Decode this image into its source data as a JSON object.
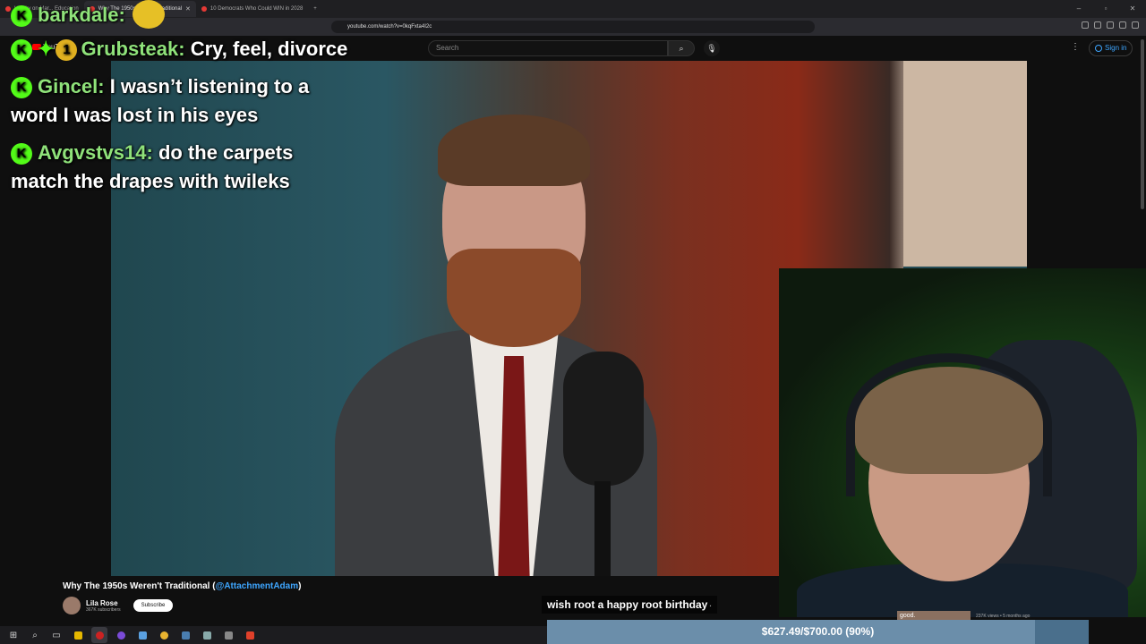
{
  "browser": {
    "tabs": [
      {
        "label": "Livinky on Mar... Education",
        "active": false
      },
      {
        "label": "Why The 1950s Weren't Traditional",
        "active": true
      },
      {
        "label": "10 Democrats Who Could WIN in 2028",
        "active": false
      }
    ],
    "url": "youtube.com/watch?v=0kqFxta4I2c"
  },
  "youtube": {
    "logo_text": "YouTube",
    "search_placeholder": "Search",
    "sign_in": "Sign in"
  },
  "chat": [
    {
      "user": "barkdale:",
      "message": ""
    },
    {
      "user": "Grubsteak:",
      "message": "Cry, feel, divorce"
    },
    {
      "user": "Gincel:",
      "message": "I wasn’t listening to a word I was lost in his eyes"
    },
    {
      "user": "Avgvstvs14:",
      "message": "do the carpets match the drapes with twileks"
    }
  ],
  "badge_one": "1",
  "video": {
    "title": "Why The 1950s Weren't Traditional (",
    "handle": "@AttachmentAdam",
    "title_end": ")",
    "channel": "Lila Rose",
    "subscribers": "367K subscribers",
    "subscribe_label": "Subscribe"
  },
  "caption": "wish root a happy root birthday",
  "mini": {
    "thumb_text": "good.",
    "views": "237K views • 5 months ago"
  },
  "goal": {
    "text": "$627.49/$700.00 (90%)",
    "current": 627.49,
    "target": 700.0,
    "fraction": 0.9
  },
  "colors": {
    "kick_green": "#53fc18",
    "chat_name": "#8fe27a",
    "yt_blue": "#3ea6ff",
    "goal_bar": "#4a6f8c"
  },
  "icons": [
    "kick-icon",
    "search-icon",
    "mic-icon",
    "user-icon",
    "windows-start-icon",
    "close-icon"
  ]
}
